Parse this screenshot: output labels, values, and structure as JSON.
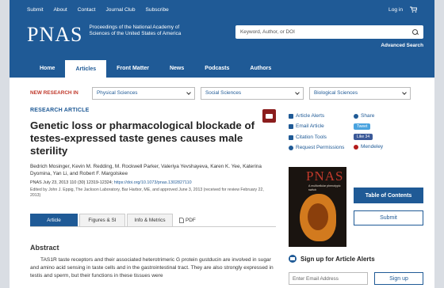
{
  "topbar": {
    "links": [
      "Submit",
      "About",
      "Contact",
      "Journal Club",
      "Subscribe"
    ],
    "login": "Log in"
  },
  "brand": {
    "logo": "PNAS",
    "tagline": "Proceedings of the National Academy of Sciences of the United States of America",
    "search_placeholder": "Keyword, Author, or DOI",
    "advanced": "Advanced Search"
  },
  "nav": [
    "Home",
    "Articles",
    "Front Matter",
    "News",
    "Podcasts",
    "Authors"
  ],
  "nav_active": "Articles",
  "new_research": {
    "label": "NEW RESEARCH IN",
    "selects": [
      "Physical Sciences",
      "Social Sciences",
      "Biological Sciences"
    ]
  },
  "article": {
    "kicker": "RESEARCH ARTICLE",
    "title": "Genetic loss or pharmacological blockade of testes-expressed taste genes causes male sterility",
    "authors": "Bedrich Mosinger, Kevin M. Redding, M. Rockwell Parker, Valeriya Yevshayeva, Karen K. Yee, Katerina Dyomina, Yan Li, and Robert F. Margolskee",
    "cite_text": "PNAS July 23, 2013 110 (30) 12319-12324;",
    "doi": "https://doi.org/10.1073/pnas.1302827110",
    "edited": "Edited by John J. Eppig, The Jackson Laboratory, Bar Harbor, ME, and approved June 3, 2013 (received for review February 22, 2013)"
  },
  "tabs": [
    "Article",
    "Figures & SI",
    "Info & Metrics"
  ],
  "pdf_label": "PDF",
  "abstract": {
    "heading": "Abstract",
    "text": "TAS1R taste receptors and their associated heterotrimeric G protein gustducin are involved in sugar and amino acid sensing in taste cells and in the gastrointestinal tract. They are also strongly expressed in testis and sperm, but their functions in these tissues were"
  },
  "tools": [
    "Article Alerts",
    "Email Article",
    "Citation Tools",
    "Request Permissions"
  ],
  "share": {
    "label": "Share",
    "tweet": "Tweet",
    "like": "Like 34",
    "mendeley": "Mendeley"
  },
  "cover": {
    "title": "PNAS",
    "subtitle": "A multicellular phenotypic switch"
  },
  "sidebar_buttons": {
    "toc": "Table of Contents",
    "submit": "Submit"
  },
  "alerts": {
    "heading": "Sign up for Article Alerts",
    "placeholder": "Enter Email Address",
    "button": "Sign up"
  }
}
